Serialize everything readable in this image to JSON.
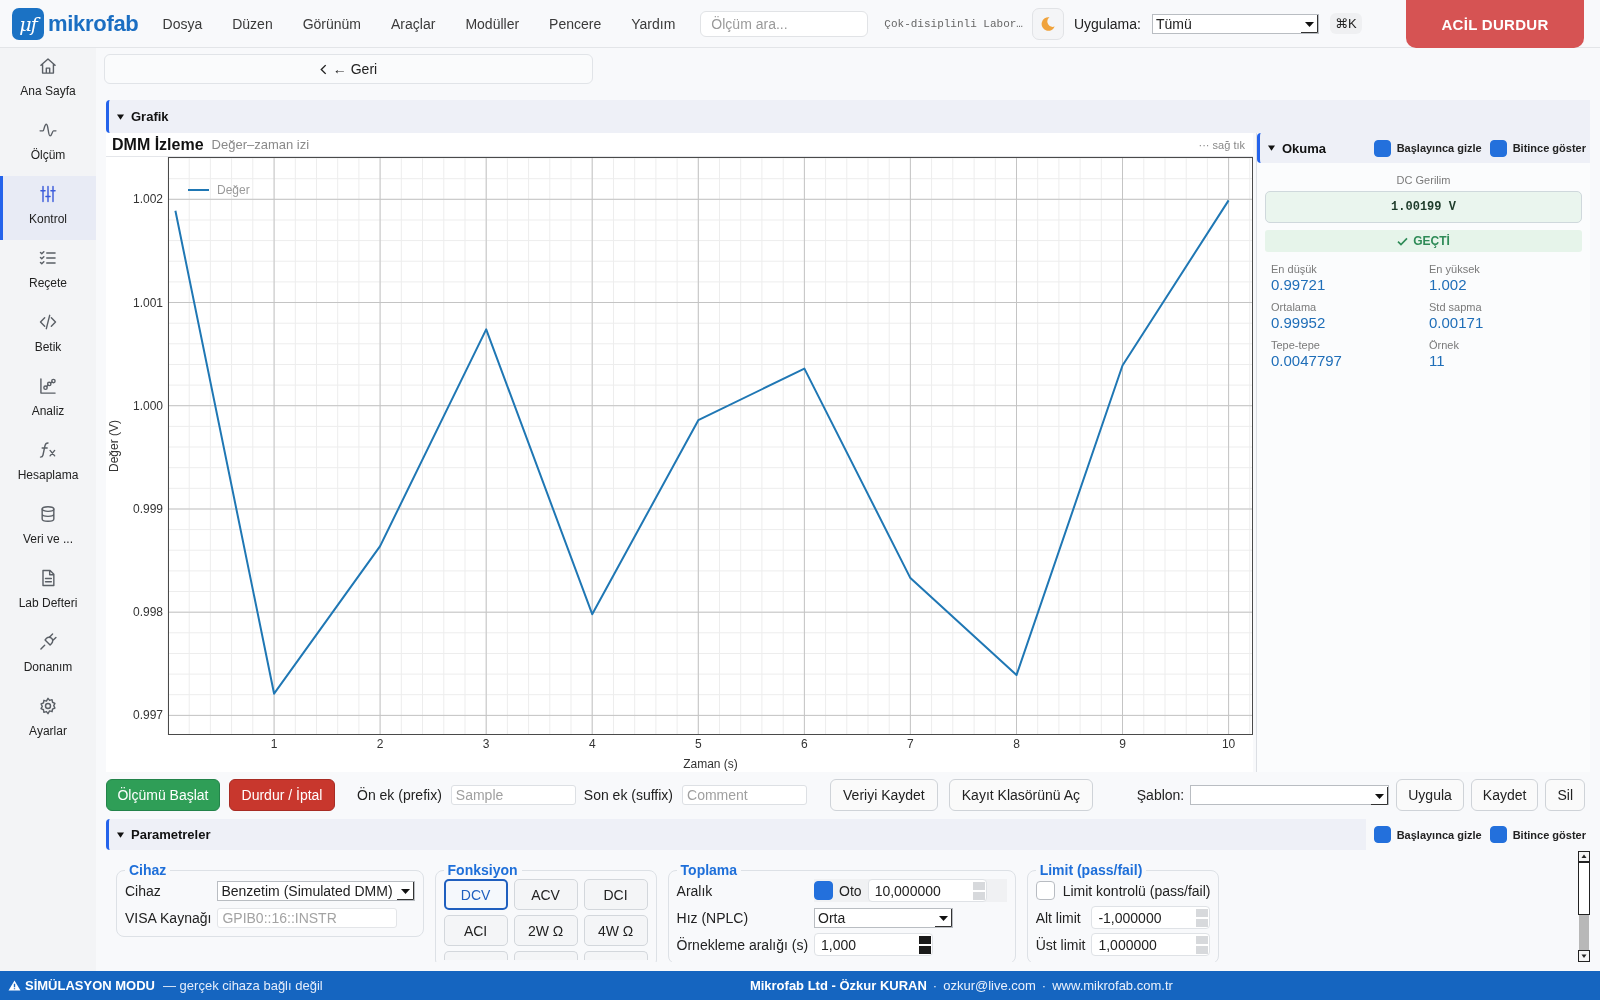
{
  "app_bar": {
    "logo": {
      "mark": "μf",
      "name": "mikrofab"
    },
    "menu": [
      "Dosya",
      "Düzen",
      "Görünüm",
      "Araçlar",
      "Modüller",
      "Pencere",
      "Yardım"
    ],
    "search": {
      "placeholder": "Ölçüm ara..."
    },
    "workspace": "Çok-disiplinli Labor…",
    "app_filter": {
      "label": "Uygulama:",
      "value": "Tümü"
    },
    "shortcut": "⌘K",
    "emergency_stop": "ACİL DURDUR"
  },
  "sidebar": {
    "items": [
      {
        "label": "Ana Sayfa",
        "kind": "home",
        "selected": false
      },
      {
        "label": "Ölçüm",
        "kind": "wave",
        "selected": false
      },
      {
        "label": "Kontrol",
        "kind": "sliders",
        "selected": true
      },
      {
        "label": "Reçete",
        "kind": "checklist",
        "selected": false
      },
      {
        "label": "Betik",
        "kind": "code",
        "selected": false
      },
      {
        "label": "Analiz",
        "kind": "chart",
        "selected": false
      },
      {
        "label": "Hesaplama",
        "kind": "function",
        "selected": false
      },
      {
        "label": "Veri ve ...",
        "kind": "database",
        "selected": false
      },
      {
        "label": "Lab Defteri",
        "kind": "document",
        "selected": false
      },
      {
        "label": "Donanım",
        "kind": "plug",
        "selected": false
      },
      {
        "label": "Ayarlar",
        "kind": "gear",
        "selected": false
      }
    ]
  },
  "back_button": "← Geri",
  "chart_section": {
    "title": "Grafik",
    "expanded": true,
    "chart": {
      "title": "DMM İzleme",
      "subtitle": "Değer–zaman izi",
      "menu_hint": "··· sağ tık",
      "chart_data": {
        "type": "line",
        "xlabel": "Zaman (s)",
        "ylabel": "Değer (V)",
        "x": [
          0.07,
          1,
          2,
          3,
          4,
          5,
          6,
          7,
          8,
          9,
          10
        ],
        "series": [
          {
            "name": "Değer",
            "color": "#1f77b4",
            "values": [
              1.00189,
              0.99721,
              0.99864,
              1.00074,
              0.99798,
              0.99986,
              1.00036,
              0.99833,
              0.99739,
              1.00039,
              1.00199
            ]
          }
        ],
        "xlim": [
          0,
          10.23
        ],
        "ylim": [
          0.99681,
          1.00241
        ],
        "xticks": [
          1,
          2,
          3,
          4,
          5,
          6,
          7,
          8,
          9,
          10
        ],
        "yticks": [
          {
            "value": 0.997,
            "label": "0.997"
          },
          {
            "value": 0.998,
            "label": "0.998"
          },
          {
            "value": 0.999,
            "label": "0.999"
          },
          {
            "value": 1.0,
            "label": "1.000"
          },
          {
            "value": 1.001,
            "label": "1.001"
          },
          {
            "value": 1.002,
            "label": "1.002"
          }
        ],
        "grid": true
      }
    },
    "reading_panel": {
      "title": "Okuma",
      "expanded": true,
      "options": [
        {
          "label": "Başlayınca gizle",
          "checked": true
        },
        {
          "label": "Bitince göster",
          "checked": true
        }
      ],
      "quantity": "DC Gerilim",
      "value": "1.00199 V",
      "verdict": {
        "text": "GEÇTİ",
        "passed": true
      },
      "stats": [
        {
          "label": "En düşük",
          "value": "0.99721"
        },
        {
          "label": "En yüksek",
          "value": "1.002"
        },
        {
          "label": "Ortalama",
          "value": "0.99952"
        },
        {
          "label": "Std sapma",
          "value": "0.00171"
        },
        {
          "label": "Tepe-tepe",
          "value": "0.0047797"
        },
        {
          "label": "Örnek",
          "value": "11"
        }
      ]
    }
  },
  "actions": {
    "start": "Ölçümü Başlat",
    "stop": "Durdur / İptal",
    "prefix": {
      "label": "Ön ek (prefix)",
      "placeholder": "Sample"
    },
    "suffix": {
      "label": "Son ek (suffix)",
      "placeholder": "Comment"
    },
    "save": "Veriyi Kaydet",
    "open_folder": "Kayıt Klasörünü Aç",
    "template": {
      "label": "Şablon:"
    },
    "template_buttons": [
      "Uygula",
      "Kaydet",
      "Sil"
    ]
  },
  "parameters_section": {
    "title": "Parametreler",
    "expanded": true,
    "options": [
      {
        "label": "Başlayınca gizle",
        "checked": true
      },
      {
        "label": "Bitince göster",
        "checked": true
      }
    ],
    "groups": [
      {
        "title": "Cihaz",
        "kind": "form",
        "rows": [
          {
            "kind": "select",
            "label": "Cihaz",
            "value": "Benzetim (Simulated DMM)"
          },
          {
            "kind": "text",
            "label": "VISA Kaynağı",
            "placeholder": "GPIB0::16::INSTR"
          }
        ]
      },
      {
        "title": "Fonksiyon",
        "kind": "buttons",
        "buttons": [
          {
            "kind": "full",
            "label": "DCV",
            "selected": true
          },
          {
            "kind": "full",
            "label": "ACV",
            "selected": false
          },
          {
            "kind": "full",
            "label": "DCI",
            "selected": false
          },
          {
            "kind": "full",
            "label": "ACI",
            "selected": false
          },
          {
            "kind": "full",
            "label": "2W Ω",
            "selected": false
          },
          {
            "kind": "full",
            "label": "4W Ω",
            "selected": false
          },
          {
            "kind": "clipped",
            "selected": false
          },
          {
            "kind": "clipped",
            "selected": false
          },
          {
            "kind": "clipped",
            "selected": false
          }
        ]
      },
      {
        "title": "Toplama",
        "kind": "form",
        "rows": [
          {
            "kind": "auto_number",
            "label": "Aralık",
            "auto_label": "Oto",
            "auto": true,
            "value": "10,000000",
            "disabled": true
          },
          {
            "kind": "select",
            "label": "Hız (NPLC)",
            "value": "Orta"
          },
          {
            "kind": "number",
            "label": "Örnekleme aralığı (s)",
            "value": "1,000",
            "disabled": false
          }
        ]
      },
      {
        "title": "Limit (pass/fail)",
        "kind": "form",
        "rows": [
          {
            "kind": "checkbox",
            "label": "Limit kontrolü (pass/fail)",
            "checked": false
          },
          {
            "kind": "number",
            "label": "Alt limit",
            "value": "-1,000000",
            "disabled": true
          },
          {
            "kind": "number",
            "label": "Üst limit",
            "value": "1,000000",
            "disabled": true
          }
        ]
      }
    ]
  },
  "status_bar": {
    "mode": "SİMÜLASYON MODU",
    "note": "— gerçek cihaza bağlı değil",
    "info": [
      {
        "kind": "owner",
        "text": "Mikrofab Ltd - Özkur KURAN"
      },
      {
        "kind": "separator",
        "text": "·"
      },
      {
        "kind": "email",
        "text": "ozkur@live.com"
      },
      {
        "kind": "separator",
        "text": "·"
      },
      {
        "kind": "website",
        "text": "www.mikrofab.com.tr"
      }
    ]
  }
}
